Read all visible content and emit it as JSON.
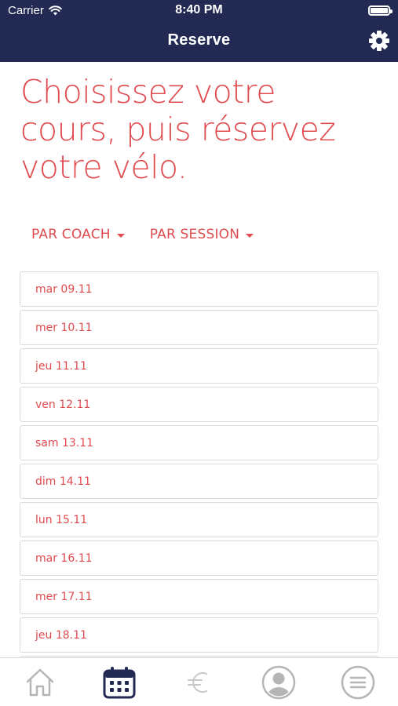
{
  "status_bar": {
    "carrier": "Carrier",
    "time": "8:40 PM"
  },
  "nav": {
    "title": "Reserve",
    "settings_icon": "gear-icon"
  },
  "headline": {
    "line1": "Choisissez votre",
    "line2": "cours, puis réservez",
    "line3": "votre vélo."
  },
  "filters": [
    {
      "label": "PAR COACH"
    },
    {
      "label": "PAR SESSION"
    }
  ],
  "dates": [
    {
      "label": "mar 09.11"
    },
    {
      "label": "mer 10.11"
    },
    {
      "label": "jeu 11.11"
    },
    {
      "label": "ven 12.11"
    },
    {
      "label": "sam 13.11"
    },
    {
      "label": "dim 14.11"
    },
    {
      "label": "lun 15.11"
    },
    {
      "label": "mar 16.11"
    },
    {
      "label": "mer 17.11"
    },
    {
      "label": "jeu 18.11"
    }
  ],
  "tab_bar": {
    "tabs": [
      {
        "icon": "home-icon",
        "active": false
      },
      {
        "icon": "calendar-icon",
        "active": true
      },
      {
        "icon": "euro-icon",
        "active": false
      },
      {
        "icon": "profile-icon",
        "active": false
      },
      {
        "icon": "menu-icon",
        "active": false
      }
    ]
  },
  "colors": {
    "header_bg": "#222a54",
    "accent": "#e04b4f",
    "inactive_icon": "#b5b5b5",
    "active_icon": "#222a54"
  }
}
